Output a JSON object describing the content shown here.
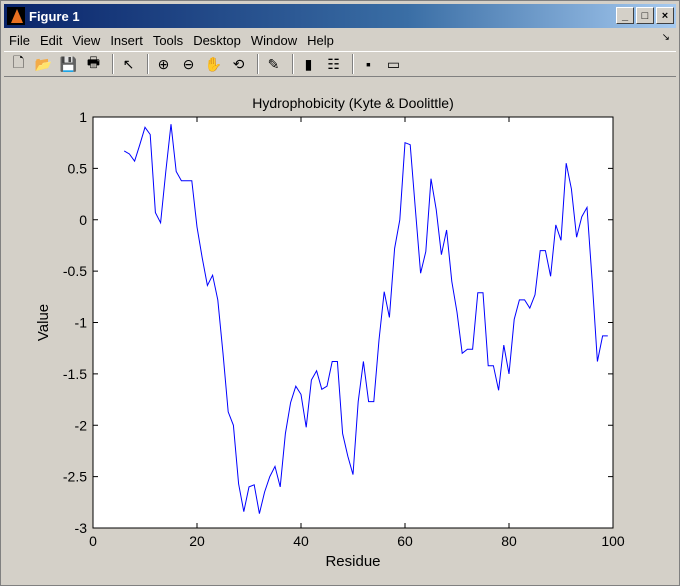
{
  "window": {
    "title": "Figure 1",
    "controls": [
      "_",
      "□",
      "×"
    ]
  },
  "menu": [
    "File",
    "Edit",
    "View",
    "Insert",
    "Tools",
    "Desktop",
    "Window",
    "Help"
  ],
  "toolbar": [
    {
      "name": "new-figure-icon",
      "glyph": "🗋"
    },
    {
      "name": "open-icon",
      "glyph": "📂"
    },
    {
      "name": "save-icon",
      "glyph": "💾"
    },
    {
      "name": "print-icon",
      "glyph": "🖶"
    },
    {
      "sep": true
    },
    {
      "name": "edit-plot-icon",
      "glyph": "↖"
    },
    {
      "sep": true
    },
    {
      "name": "zoom-in-icon",
      "glyph": "⊕"
    },
    {
      "name": "zoom-out-icon",
      "glyph": "⊖"
    },
    {
      "name": "pan-icon",
      "glyph": "✋"
    },
    {
      "name": "rotate-3d-icon",
      "glyph": "⟲"
    },
    {
      "sep": true
    },
    {
      "name": "data-cursor-icon",
      "glyph": "✎"
    },
    {
      "sep": true
    },
    {
      "name": "colorbar-icon",
      "glyph": "▮"
    },
    {
      "name": "legend-icon",
      "glyph": "☷"
    },
    {
      "sep": true
    },
    {
      "name": "hide-plot-tools-icon",
      "glyph": "▪"
    },
    {
      "name": "show-plot-tools-icon",
      "glyph": "▭"
    }
  ],
  "chart_data": {
    "type": "line",
    "title": "Hydrophobicity (Kyte & Doolittle)",
    "xlabel": "Residue",
    "ylabel": "Value",
    "xlim": [
      0,
      100
    ],
    "ylim": [
      -3,
      1
    ],
    "xticks": [
      0,
      20,
      40,
      60,
      80,
      100
    ],
    "yticks": [
      1,
      0.5,
      0,
      -0.5,
      -1,
      -1.5,
      -2,
      -2.5,
      -3
    ],
    "color": "#0000ff",
    "x_start": 6,
    "values": [
      0.67,
      0.64,
      0.57,
      0.73,
      0.9,
      0.83,
      0.07,
      -0.03,
      0.47,
      0.93,
      0.47,
      0.38,
      0.38,
      0.38,
      -0.07,
      -0.37,
      -0.64,
      -0.54,
      -0.78,
      -1.3,
      -1.87,
      -2.0,
      -2.57,
      -2.84,
      -2.6,
      -2.58,
      -2.86,
      -2.65,
      -2.5,
      -2.4,
      -2.6,
      -2.08,
      -1.78,
      -1.62,
      -1.7,
      -2.02,
      -1.56,
      -1.47,
      -1.65,
      -1.62,
      -1.38,
      -1.38,
      -2.08,
      -2.3,
      -2.48,
      -1.77,
      -1.38,
      -1.77,
      -1.77,
      -1.17,
      -0.7,
      -0.95,
      -0.28,
      0.0,
      0.75,
      0.73,
      0.1,
      -0.52,
      -0.31,
      0.4,
      0.1,
      -0.34,
      -0.1,
      -0.6,
      -0.9,
      -1.3,
      -1.26,
      -1.26,
      -0.71,
      -0.71,
      -1.42,
      -1.42,
      -1.66,
      -1.22,
      -1.5,
      -0.97,
      -0.78,
      -0.78,
      -0.86,
      -0.73,
      -0.3,
      -0.3,
      -0.55,
      -0.05,
      -0.2,
      0.55,
      0.3,
      -0.17,
      0.03,
      0.12,
      -0.6,
      -1.38,
      -1.13,
      -1.13
    ]
  }
}
